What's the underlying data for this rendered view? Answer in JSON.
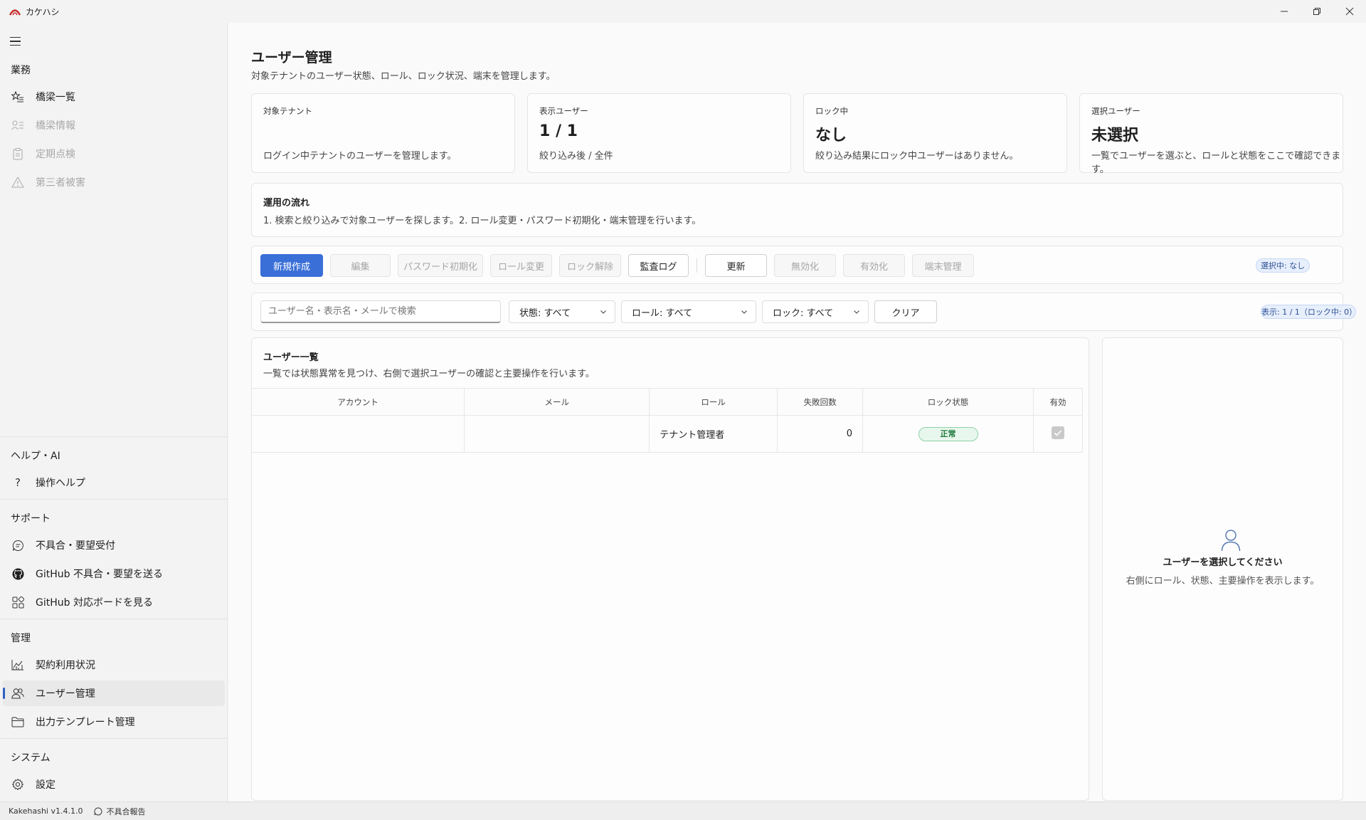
{
  "window": {
    "title": "カケハシ"
  },
  "sidebar": {
    "sections": {
      "business": "業務",
      "help": "ヘルプ・AI",
      "support": "サポート",
      "admin": "管理",
      "system": "システム"
    },
    "items": [
      {
        "label": "橋梁一覧",
        "icon": "star-list-icon",
        "state": "normal"
      },
      {
        "label": "橋梁情報",
        "icon": "person-list-icon",
        "state": "disabled"
      },
      {
        "label": "定期点検",
        "icon": "clipboard-icon",
        "state": "disabled"
      },
      {
        "label": "第三者被害",
        "icon": "warning-icon",
        "state": "disabled"
      },
      {
        "label": "操作ヘルプ",
        "icon": "question-icon",
        "state": "normal"
      },
      {
        "label": "不具合・要望受付",
        "icon": "chat-icon",
        "state": "normal"
      },
      {
        "label": "GitHub 不具合・要望を送る",
        "icon": "github-icon",
        "state": "normal"
      },
      {
        "label": "GitHub 対応ボードを見る",
        "icon": "board-icon",
        "state": "normal"
      },
      {
        "label": "契約利用状況",
        "icon": "chart-icon",
        "state": "normal"
      },
      {
        "label": "ユーザー管理",
        "icon": "users-icon",
        "state": "active"
      },
      {
        "label": "出力テンプレート管理",
        "icon": "folder-icon",
        "state": "normal"
      },
      {
        "label": "設定",
        "icon": "gear-icon",
        "state": "normal"
      }
    ]
  },
  "page": {
    "title": "ユーザー管理",
    "subtitle": "対象テナントのユーザー状態、ロール、ロック状況、端末を管理します。"
  },
  "stats": [
    {
      "caption": "対象テナント",
      "value": "",
      "desc": "ログイン中テナントのユーザーを管理します。"
    },
    {
      "caption": "表示ユーザー",
      "value": "1 / 1",
      "desc": "絞り込み後 / 全件"
    },
    {
      "caption": "ロック中",
      "value": "なし",
      "desc": "絞り込み結果にロック中ユーザーはありません。"
    },
    {
      "caption": "選択ユーザー",
      "value": "未選択",
      "desc": "一覧でユーザーを選ぶと、ロールと状態をここで確認できます。"
    }
  ],
  "flow": {
    "title": "運用の流れ",
    "desc": "1. 検索と絞り込みで対象ユーザーを探します。2. ロール変更・パスワード初期化・端末管理を行います。"
  },
  "toolbar": {
    "new": "新規作成",
    "edit": "編集",
    "reset_password": "パスワード初期化",
    "change_role": "ロール変更",
    "unlock": "ロック解除",
    "audit_log": "監査ログ",
    "refresh": "更新",
    "disable": "無効化",
    "enable": "有効化",
    "devices": "端末管理",
    "selected_badge": "選択中: なし"
  },
  "filters": {
    "search_placeholder": "ユーザー名・表示名・メールで検索",
    "status": "状態: すべて",
    "role": "ロール: すべて",
    "lock": "ロック: すべて",
    "clear": "クリア",
    "count_badge": "表示: 1 / 1（ロック中: 0）"
  },
  "user_list": {
    "title": "ユーザー一覧",
    "subtitle": "一覧では状態異常を見つけ、右側で選択ユーザーの確認と主要操作を行います。",
    "columns": [
      "アカウント",
      "メール",
      "ロール",
      "失敗回数",
      "ロック状態",
      "有効"
    ],
    "rows": [
      {
        "account": "",
        "email": "",
        "role": "テナント管理者",
        "failures": "0",
        "lock_status": "正常",
        "enabled": true
      }
    ]
  },
  "detail": {
    "empty_title": "ユーザーを選択してください",
    "empty_sub": "右側にロール、状態、主要操作を表示します。"
  },
  "statusbar": {
    "version": "Kakehashi v1.4.1.0",
    "report": "不具合報告"
  },
  "colors": {
    "accent": "#3a6fd8",
    "ok_badge_bg": "#e8f7ed",
    "ok_badge_text": "#1f7a3d"
  }
}
